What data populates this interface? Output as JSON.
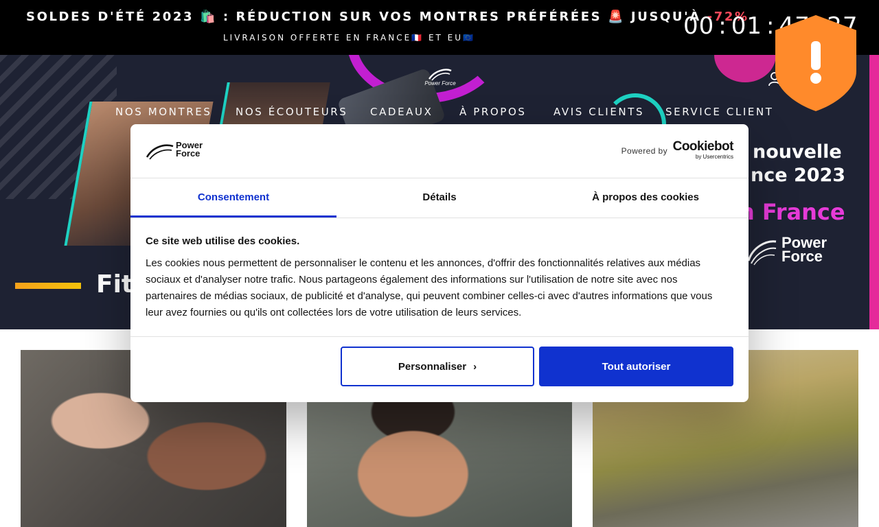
{
  "promo": {
    "headline_prefix": "SOLDES D'ÉTÉ 2023 🛍️ : RÉDUCTION SUR VOS MONTRES PRÉFÉRÉES 🚨 JUSQU'À",
    "headline_discount": "-72%",
    "subline": "LIVRAISON OFFERTE EN FRANCE🇫🇷 ET EU🇪🇺",
    "countdown": {
      "hours": "00",
      "minutes": "01",
      "seconds": "47",
      "centis": "27",
      "separator": ":"
    }
  },
  "header": {
    "logo_text": "Power Force",
    "nav": [
      "NOS MONTRES",
      "NOS ÉCOUTEURS",
      "CADEAUX",
      "À PROPOS",
      "AVIS CLIENTS",
      "SERVICE CLIENT"
    ]
  },
  "hero": {
    "line_1": "nouvelle",
    "line_2": "nce 2023",
    "line_3": "n France",
    "brand_line_1": "Power",
    "brand_line_2": "Force",
    "partial_text": "Fitp"
  },
  "cookie_dialog": {
    "logo_line_1": "Power",
    "logo_line_2": "Force",
    "powered_by": "Powered by",
    "cookiebot_name": "Cookiebot",
    "cookiebot_sub": "by Usercentrics",
    "tabs": [
      "Consentement",
      "Détails",
      "À propos des cookies"
    ],
    "active_tab": "Consentement",
    "heading": "Ce site web utilise des cookies.",
    "body": "Les cookies nous permettent de personnaliser le contenu et les annonces, d'offrir des fonctionnalités relatives aux médias sociaux et d'analyser notre trafic. Nous partageons également des informations sur l'utilisation de notre site avec nos partenaires de médias sociaux, de publicité et d'analyse, qui peuvent combiner celles-ci avec d'autres informations que vous leur avez fournies ou qu'ils ont collectées lors de votre utilisation de leurs services.",
    "btn_customize": "Personnaliser",
    "btn_allow": "Tout autoriser",
    "accent_color": "#1032cf"
  },
  "alert_badge": {
    "symbol": "!",
    "color": "#ff8a2b"
  },
  "colors": {
    "promo_bg": "#000000",
    "sale_red": "#ff4a5c",
    "hero_bg": "#1e2233",
    "hero_pink": "#e63bd8"
  }
}
